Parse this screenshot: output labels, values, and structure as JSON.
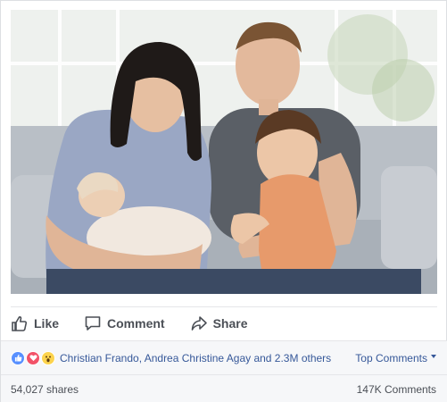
{
  "actions": {
    "like_label": "Like",
    "comment_label": "Comment",
    "share_label": "Share"
  },
  "reactions": {
    "icons": [
      "like-reaction-icon",
      "love-reaction-icon",
      "wow-reaction-icon"
    ],
    "reactors_text": "Christian Frando, Andrea Christine Agay and 2.3M others",
    "sort_label": "Top Comments"
  },
  "stats": {
    "shares": "54,027 shares",
    "comments": "147K Comments"
  },
  "colors": {
    "link": "#365899",
    "action_text": "#4b4f56",
    "like_reaction": "#5890ff",
    "love_reaction": "#f25268",
    "wow_reaction": "#fcd34d",
    "footer_bg": "#f6f7f9"
  }
}
